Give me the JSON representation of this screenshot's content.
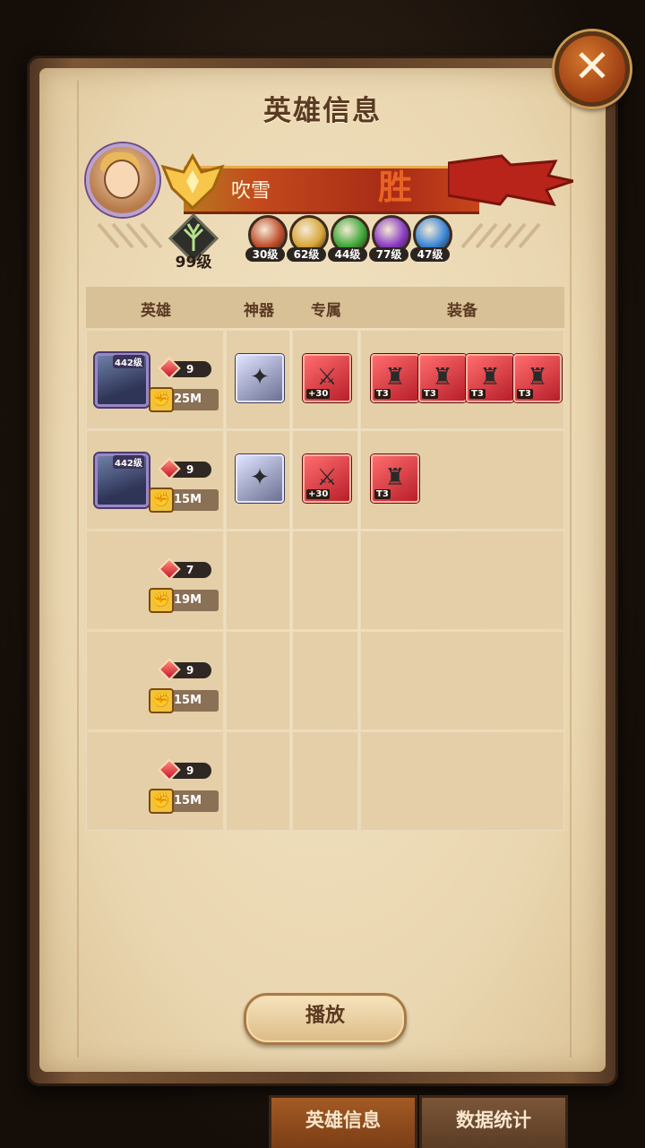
{
  "header": {
    "title": "英雄信息",
    "close_icon": "close-icon"
  },
  "player": {
    "name": "吹雪",
    "result": "胜",
    "avatar_icon": "player-avatar",
    "tree_level": "99级",
    "factions": [
      {
        "icon": "lightbearer-icon",
        "level": "30级",
        "color": "#c0502e"
      },
      {
        "icon": "mauler-icon",
        "level": "62级",
        "color": "#d8a63a"
      },
      {
        "icon": "wilder-icon",
        "level": "44级",
        "color": "#3fa838"
      },
      {
        "icon": "graveborn-icon",
        "level": "77级",
        "color": "#8b3cc4"
      },
      {
        "icon": "celestial-icon",
        "level": "47级",
        "color": "#3a86d8"
      }
    ]
  },
  "table": {
    "headers": {
      "hero": "英雄",
      "artifact": "神器",
      "exclusive": "专属",
      "equipment": "装备"
    },
    "rows": [
      {
        "has_portrait": true,
        "portrait_level": "442级",
        "signature": "9",
        "power": "25M",
        "artifact": "silver-artifact-icon",
        "exclusive_tag": "+30",
        "equipment": [
          {
            "tag": "T3"
          },
          {
            "tag": "T3"
          },
          {
            "tag": "T3"
          },
          {
            "tag": "T3"
          }
        ]
      },
      {
        "has_portrait": true,
        "portrait_level": "442级",
        "signature": "9",
        "power": "15M",
        "artifact": "red-artifact-icon",
        "exclusive_tag": "+30",
        "equipment": [
          {
            "tag": "T3"
          }
        ]
      },
      {
        "has_portrait": false,
        "signature": "7",
        "power": "19M"
      },
      {
        "has_portrait": false,
        "signature": "9",
        "power": "15M"
      },
      {
        "has_portrait": false,
        "signature": "9",
        "power": "15M"
      }
    ]
  },
  "play_button": {
    "label": "播放"
  },
  "tabs": [
    {
      "label": "英雄信息",
      "active": true
    },
    {
      "label": "数据统计",
      "active": false
    }
  ]
}
